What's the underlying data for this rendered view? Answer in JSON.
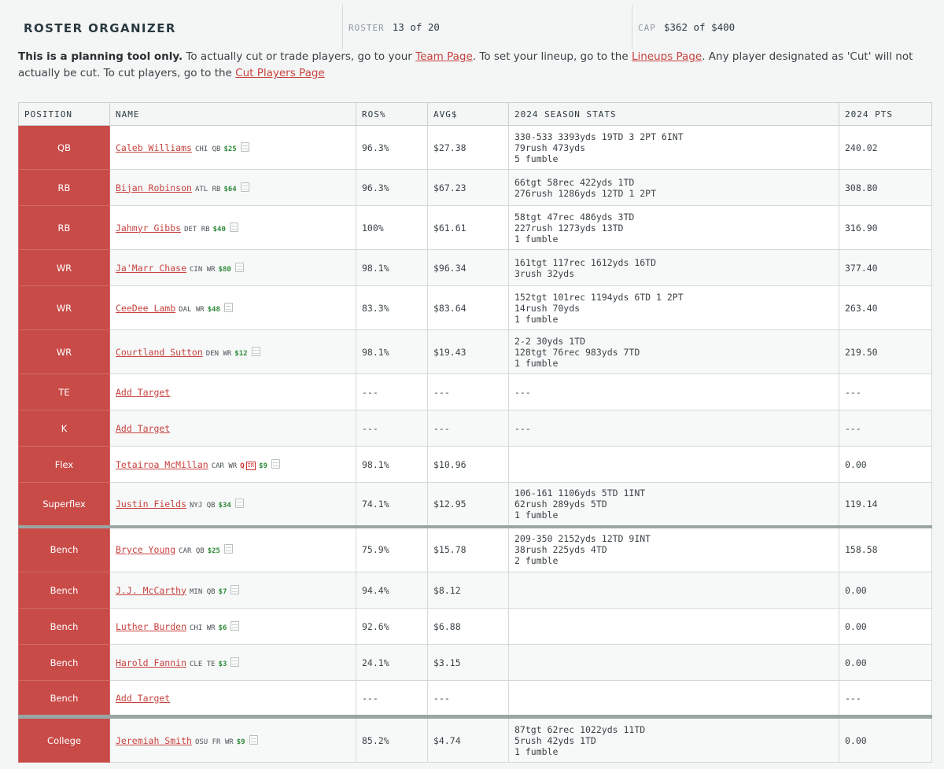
{
  "header": {
    "title": "ROSTER ORGANIZER",
    "roster_label": "ROSTER",
    "roster_value": "13 of 20",
    "cap_label": "CAP",
    "cap_value": "$362 of $400"
  },
  "notice": {
    "bold": "This is a planning tool only.",
    "t1": " To actually cut or trade players, go to your ",
    "team_link": "Team Page",
    "t2": ". To set your lineup, go to the ",
    "lineups_link": "Lineups Page",
    "t3": ". Any player designated as 'Cut' will not actually be cut. To cut players, go to the ",
    "cut_link": "Cut Players Page"
  },
  "columns": [
    "POSITION",
    "NAME",
    "ROS%",
    "AVG$",
    "2024 SEASON STATS",
    "2024 PTS"
  ],
  "rows": [
    {
      "position": "QB",
      "name": "Caleb Williams",
      "meta": "CHI QB",
      "salary": "$25",
      "ros": "96.3%",
      "avg": "$27.38",
      "stats": "330-533 3393yds 19TD 3 2PT 6INT\n79rush 473yds\n5 fumble",
      "pts": "240.02"
    },
    {
      "position": "RB",
      "name": "Bijan Robinson",
      "meta": "ATL RB",
      "salary": "$64",
      "ros": "96.3%",
      "avg": "$67.23",
      "stats": "66tgt 58rec 422yds 1TD\n276rush 1286yds 12TD 1 2PT",
      "pts": "308.80"
    },
    {
      "position": "RB",
      "name": "Jahmyr Gibbs",
      "meta": "DET RB",
      "salary": "$40",
      "ros": "100%",
      "avg": "$61.61",
      "stats": "58tgt 47rec 486yds 3TD\n227rush 1273yds 13TD\n1 fumble",
      "pts": "316.90"
    },
    {
      "position": "WR",
      "name": "Ja'Marr Chase",
      "meta": "CIN WR",
      "salary": "$80",
      "ros": "98.1%",
      "avg": "$96.34",
      "stats": "161tgt 117rec 1612yds 16TD\n3rush 32yds",
      "pts": "377.40"
    },
    {
      "position": "WR",
      "name": "CeeDee Lamb",
      "meta": "DAL WR",
      "salary": "$48",
      "ros": "83.3%",
      "avg": "$83.64",
      "stats": "152tgt 101rec 1194yds 6TD 1 2PT\n14rush 70yds\n1 fumble",
      "pts": "263.40"
    },
    {
      "position": "WR",
      "name": "Courtland Sutton",
      "meta": "DEN WR",
      "salary": "$12",
      "ros": "98.1%",
      "avg": "$19.43",
      "stats": "2-2 30yds 1TD\n128tgt 76rec 983yds 7TD\n1 fumble",
      "pts": "219.50"
    },
    {
      "position": "TE",
      "name": "Add Target",
      "meta": "",
      "salary": "",
      "ros": "---",
      "avg": "---",
      "stats": "---",
      "pts": "---"
    },
    {
      "position": "K",
      "name": "Add Target",
      "meta": "",
      "salary": "",
      "ros": "---",
      "avg": "---",
      "stats": "---",
      "pts": "---"
    },
    {
      "position": "Flex",
      "name": "Tetairoa McMillan",
      "meta": "CAR WR",
      "status": "Q",
      "salary": "$9",
      "ros": "98.1%",
      "avg": "$10.96",
      "stats": "",
      "pts": "0.00"
    },
    {
      "position": "Superflex",
      "name": "Justin Fields",
      "meta": "NYJ QB",
      "salary": "$34",
      "ros": "74.1%",
      "avg": "$12.95",
      "stats": "106-161 1106yds 5TD 1INT\n62rush 289yds 5TD\n1 fumble",
      "pts": "119.14"
    },
    {
      "position": "Bench",
      "name": "Bryce Young",
      "meta": "CAR QB",
      "salary": "$25",
      "ros": "75.9%",
      "avg": "$15.78",
      "stats": "209-350 2152yds 12TD 9INT\n38rush 225yds 4TD\n2 fumble",
      "pts": "158.58"
    },
    {
      "position": "Bench",
      "name": "J.J. McCarthy",
      "meta": "MIN QB",
      "salary": "$7",
      "ros": "94.4%",
      "avg": "$8.12",
      "stats": "",
      "pts": "0.00"
    },
    {
      "position": "Bench",
      "name": "Luther Burden",
      "meta": "CHI WR",
      "salary": "$6",
      "ros": "92.6%",
      "avg": "$6.88",
      "stats": "",
      "pts": "0.00"
    },
    {
      "position": "Bench",
      "name": "Harold Fannin",
      "meta": "CLE TE",
      "salary": "$3",
      "ros": "24.1%",
      "avg": "$3.15",
      "stats": "",
      "pts": "0.00"
    },
    {
      "position": "Bench",
      "name": "Add Target",
      "meta": "",
      "salary": "",
      "ros": "---",
      "avg": "---",
      "stats": "",
      "pts": "---"
    },
    {
      "position": "College",
      "name": "Jeremiah Smith",
      "meta": "OSU FR WR",
      "salary": "$9",
      "ros": "85.2%",
      "avg": "$4.74",
      "stats": "87tgt 62rec 1022yds 11TD\n5rush 42yds 1TD\n1 fumble",
      "pts": "0.00"
    }
  ]
}
